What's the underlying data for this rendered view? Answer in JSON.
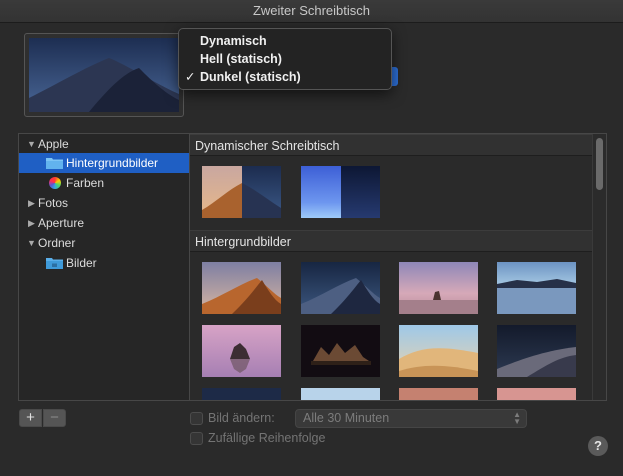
{
  "window": {
    "title": "Zweiter Schreibtisch"
  },
  "popup_menu": {
    "items": [
      {
        "label": "Dynamisch",
        "checked": false
      },
      {
        "label": "Hell (statisch)",
        "checked": false
      },
      {
        "label": "Dunkel (statisch)",
        "checked": true
      }
    ],
    "check_glyph": "✓"
  },
  "sidebar": {
    "items": [
      {
        "label": "Apple",
        "icon": "disclosure-open-icon"
      },
      {
        "label": "Hintergrundbilder",
        "icon": "folder-icon",
        "selected": true
      },
      {
        "label": "Farben",
        "icon": "color-wheel-icon"
      },
      {
        "label": "Fotos",
        "icon": "disclosure-closed-icon"
      },
      {
        "label": "Aperture",
        "icon": "disclosure-closed-icon"
      },
      {
        "label": "Ordner",
        "icon": "disclosure-open-icon"
      },
      {
        "label": "Bilder",
        "icon": "folder-icon"
      }
    ]
  },
  "main": {
    "sections": [
      {
        "title": "Dynamischer Schreibtisch"
      },
      {
        "title": "Hintergrundbilder"
      }
    ]
  },
  "bottom": {
    "add_label": "+",
    "remove_label": "−",
    "change_picture_label": "Bild ändern:",
    "interval_value": "Alle 30 Minuten",
    "random_order_label": "Zufällige Reihenfolge",
    "help_label": "?"
  },
  "colors": {
    "accent": "#1f5fc4",
    "background": "#2a2a2a"
  }
}
